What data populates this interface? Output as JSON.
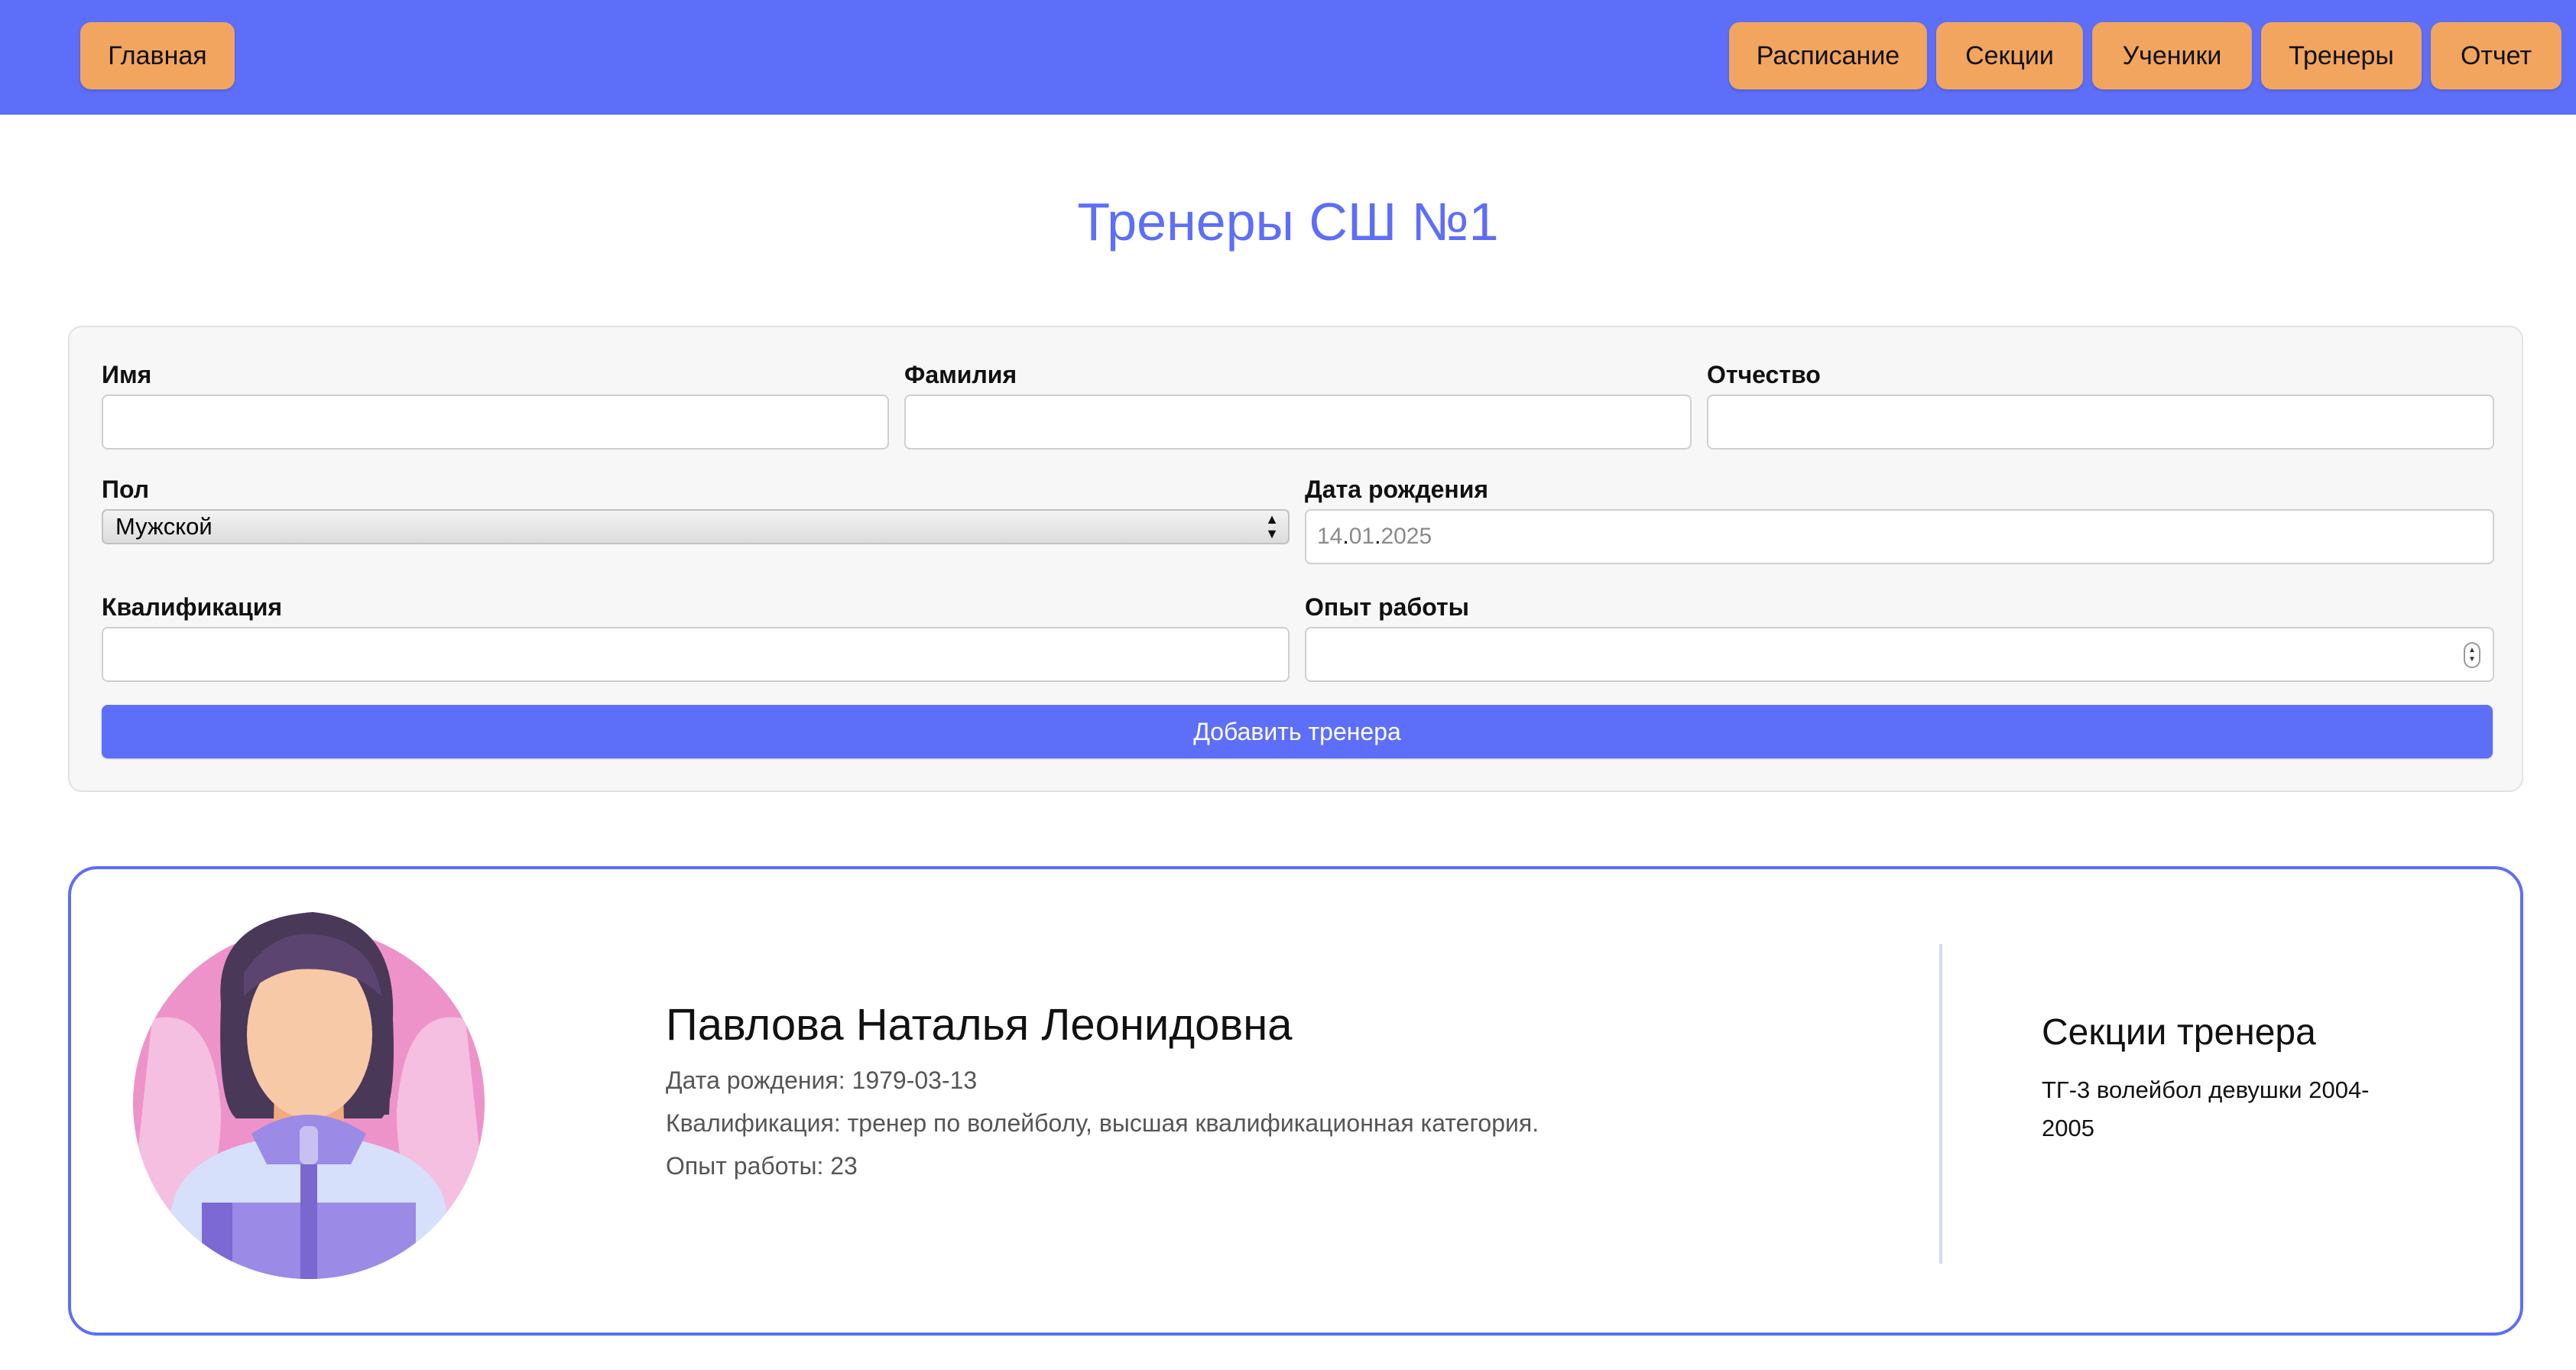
{
  "nav": {
    "home": "Главная",
    "schedule": "Расписание",
    "sections": "Секции",
    "students": "Ученики",
    "coaches": "Тренеры",
    "report": "Отчет"
  },
  "page": {
    "title": "Тренеры СШ №1"
  },
  "form": {
    "first_name_label": "Имя",
    "first_name_value": "",
    "last_name_label": "Фамилия",
    "last_name_value": "",
    "patronymic_label": "Отчество",
    "patronymic_value": "",
    "gender_label": "Пол",
    "gender_selected": "Мужской",
    "birthdate_label": "Дата рождения",
    "birthdate_day": "14",
    "birthdate_month": "01",
    "birthdate_year": "2025",
    "qualification_label": "Квалификация",
    "qualification_value": "",
    "experience_label": "Опыт работы",
    "experience_value": "",
    "submit_label": "Добавить тренера"
  },
  "coaches": [
    {
      "full_name": "Павлова Наталья Леонидовна",
      "birthdate": "Дата рождения: 1979-03-13",
      "qualification": "Квалификация: тренер по волейболу, высшая квалификационная категория.",
      "experience": "Опыт работы: 23",
      "sections_title": "Секции тренера",
      "sections": "ТГ-3 волейбол девушки 2004-2005",
      "avatar_icon": "female-coach-avatar-icon"
    }
  ],
  "colors": {
    "accent": "#5d6ef8",
    "nav_button": "#f1a55e",
    "form_background": "#f7f7f7"
  }
}
